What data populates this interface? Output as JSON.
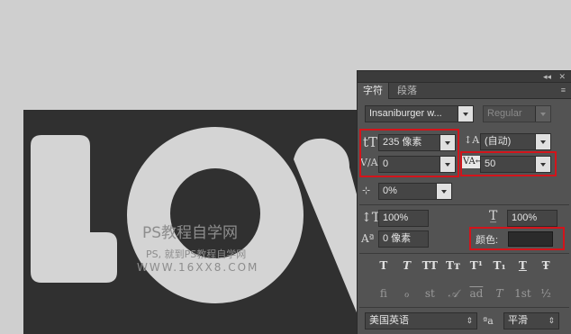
{
  "canvas": {
    "artwork_text": "LOV",
    "watermark": {
      "line1": "PS教程自学网",
      "line2": "PS, 就到PS教程自学网",
      "line3": "WWW.16XX8.COM"
    }
  },
  "panel": {
    "window_controls": {
      "collapse": "◂◂",
      "close": "✕"
    },
    "tabs": [
      {
        "label": "字符"
      },
      {
        "label": "段落"
      }
    ],
    "menu_icon": "≡",
    "font_family": "Insaniburger w...",
    "font_style": "Regular",
    "font_size": "235 像素",
    "leading": "(自动)",
    "kerning": "0",
    "tracking": "50",
    "tsume": "0%",
    "vertical_scale": "100%",
    "horizontal_scale": "100%",
    "baseline_shift": "0 像素",
    "color_label": "颜色:",
    "color_value": "#2b2b2b",
    "style_buttons": [
      "T",
      "T",
      "TT",
      "Tт",
      "T¹",
      "T₁",
      "T",
      "Ŧ"
    ],
    "opentype_buttons": [
      "fi",
      "ℴ",
      "st",
      "𝒜",
      "ad",
      "T",
      "1st",
      "½"
    ],
    "language": "美国英语",
    "aa_icon": "ªa",
    "antialias": "平滑",
    "highlight_color": "#d3141b"
  }
}
